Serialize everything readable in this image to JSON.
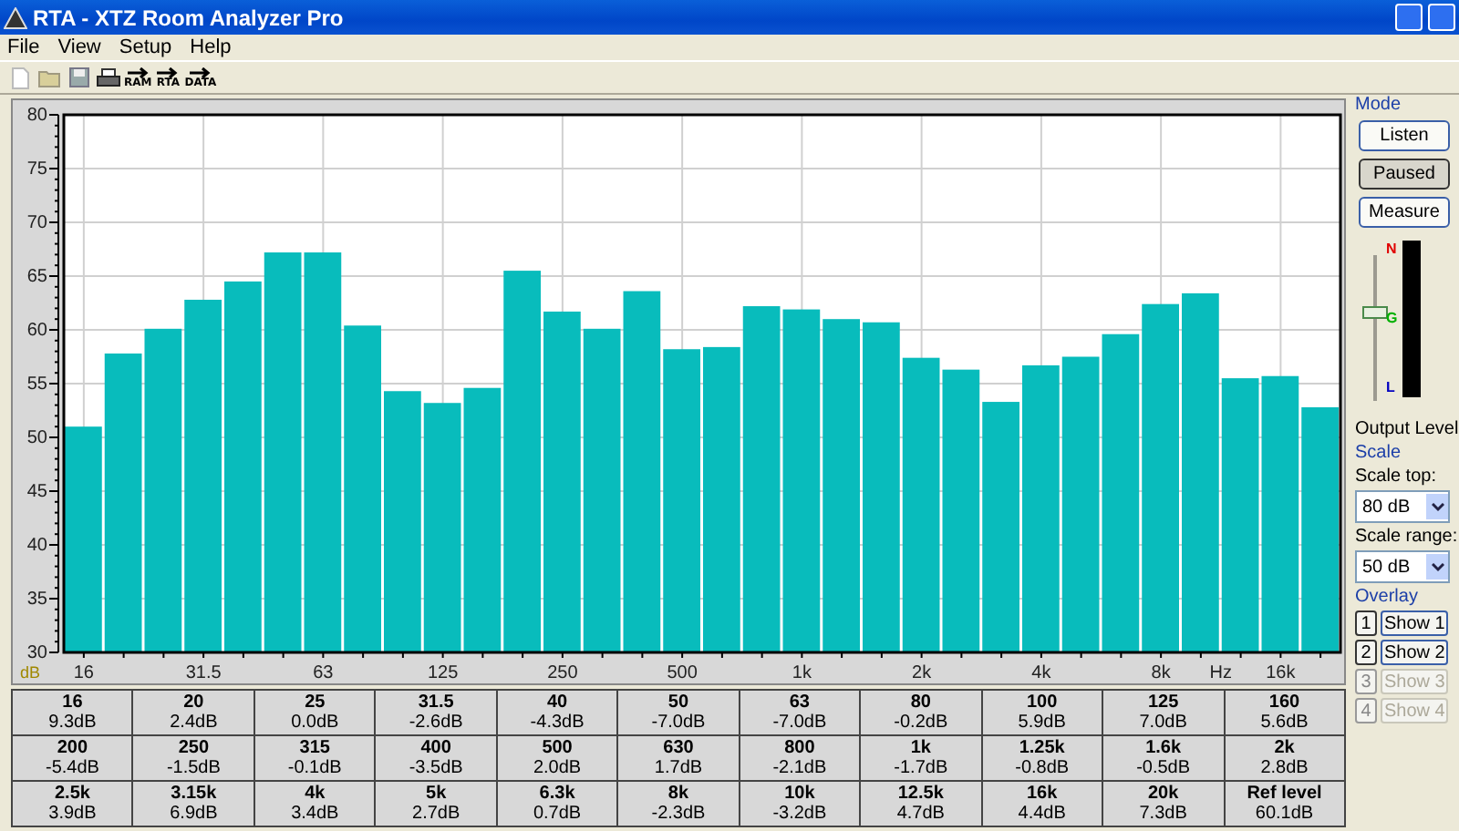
{
  "window": {
    "title": "RTA - XTZ Room Analyzer Pro"
  },
  "menu": [
    "File",
    "View",
    "Setup",
    "Help"
  ],
  "toolbar": [
    {
      "kind": "new"
    },
    {
      "kind": "open"
    },
    {
      "kind": "save"
    },
    {
      "kind": "print"
    },
    {
      "kind": "arrow",
      "label": "RAM"
    },
    {
      "kind": "arrow",
      "label": "RTA"
    },
    {
      "kind": "arrow",
      "label": "DATA"
    }
  ],
  "chart": {
    "unit_label": "dB",
    "hz_label": "Hz",
    "chart_data": {
      "type": "bar",
      "grid": true,
      "ylim": [
        30,
        80
      ],
      "yticks": [
        30,
        35,
        40,
        45,
        50,
        55,
        60,
        65,
        70,
        75,
        80
      ],
      "categories": [
        "16",
        null,
        null,
        "31.5",
        null,
        null,
        "63",
        null,
        null,
        "125",
        null,
        null,
        "250",
        null,
        null,
        "500",
        null,
        null,
        "1k",
        null,
        null,
        "2k",
        null,
        null,
        "4k",
        null,
        null,
        "8k",
        null,
        null,
        "16k",
        null
      ],
      "series": [
        {
          "color": "#08bcbc",
          "values": [
            51.0,
            57.8,
            60.1,
            62.8,
            64.5,
            67.2,
            67.2,
            60.4,
            54.3,
            53.2,
            54.6,
            65.5,
            61.7,
            60.1,
            63.6,
            58.2,
            58.4,
            62.2,
            61.9,
            61.0,
            60.7,
            57.4,
            56.3,
            53.3,
            56.7,
            57.5,
            59.6,
            62.4,
            63.4,
            55.5,
            55.7,
            52.8
          ]
        }
      ]
    }
  },
  "bands": [
    {
      "name": "16",
      "value": "9.3dB"
    },
    {
      "name": "20",
      "value": "2.4dB"
    },
    {
      "name": "25",
      "value": "0.0dB"
    },
    {
      "name": "31.5",
      "value": "-2.6dB"
    },
    {
      "name": "40",
      "value": "-4.3dB"
    },
    {
      "name": "50",
      "value": "-7.0dB"
    },
    {
      "name": "63",
      "value": "-7.0dB"
    },
    {
      "name": "80",
      "value": "-0.2dB"
    },
    {
      "name": "100",
      "value": "5.9dB"
    },
    {
      "name": "125",
      "value": "7.0dB"
    },
    {
      "name": "160",
      "value": "5.6dB"
    },
    {
      "name": "200",
      "value": "-5.4dB"
    },
    {
      "name": "250",
      "value": "-1.5dB"
    },
    {
      "name": "315",
      "value": "-0.1dB"
    },
    {
      "name": "400",
      "value": "-3.5dB"
    },
    {
      "name": "500",
      "value": "2.0dB"
    },
    {
      "name": "630",
      "value": "1.7dB"
    },
    {
      "name": "800",
      "value": "-2.1dB"
    },
    {
      "name": "1k",
      "value": "-1.7dB"
    },
    {
      "name": "1.25k",
      "value": "-0.8dB"
    },
    {
      "name": "1.6k",
      "value": "-0.5dB"
    },
    {
      "name": "2k",
      "value": "2.8dB"
    },
    {
      "name": "2.5k",
      "value": "3.9dB"
    },
    {
      "name": "3.15k",
      "value": "6.9dB"
    },
    {
      "name": "4k",
      "value": "3.4dB"
    },
    {
      "name": "5k",
      "value": "2.7dB"
    },
    {
      "name": "6.3k",
      "value": "0.7dB"
    },
    {
      "name": "8k",
      "value": "-2.3dB"
    },
    {
      "name": "10k",
      "value": "-3.2dB"
    },
    {
      "name": "12.5k",
      "value": "4.7dB"
    },
    {
      "name": "16k",
      "value": "4.4dB"
    },
    {
      "name": "20k",
      "value": "7.3dB"
    },
    {
      "name": "Ref level",
      "value": "60.1dB"
    }
  ],
  "mode": {
    "title": "Mode",
    "buttons": [
      {
        "label": "Listen",
        "selected": false
      },
      {
        "label": "Paused",
        "selected": true
      },
      {
        "label": "Measure",
        "selected": false
      }
    ],
    "output": {
      "level": 0.62,
      "label": "Output Level",
      "meter_marks": [
        "N",
        "G",
        "L"
      ]
    }
  },
  "scale": {
    "title": "Scale",
    "top_label": "Scale top:",
    "top_value": "80 dB",
    "range_label": "Scale range:",
    "range_value": "50 dB"
  },
  "overlay": {
    "title": "Overlay",
    "items": [
      {
        "number": "1",
        "label": "Show 1",
        "disabled": false
      },
      {
        "number": "2",
        "label": "Show 2",
        "disabled": false
      },
      {
        "number": "3",
        "label": "Show 3",
        "disabled": true
      },
      {
        "number": "4",
        "label": "Show 4",
        "disabled": true
      }
    ]
  }
}
